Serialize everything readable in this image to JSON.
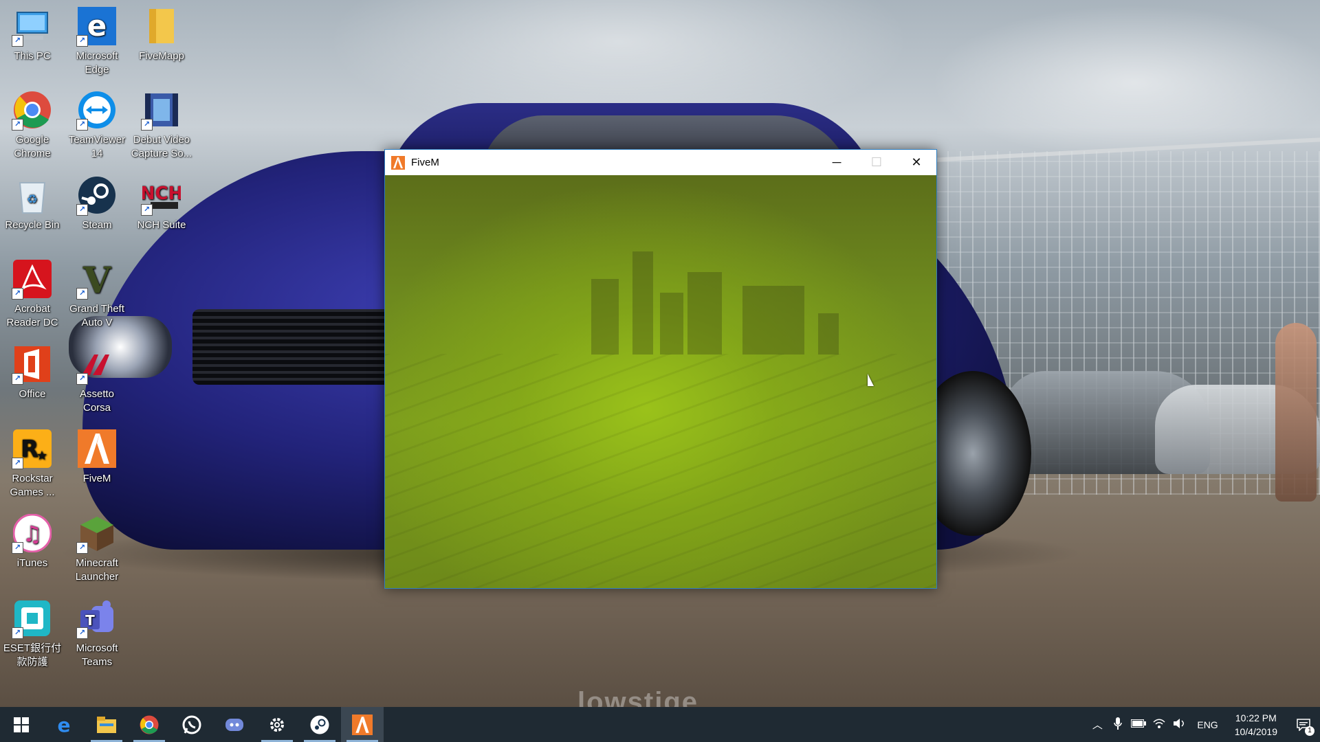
{
  "desktop": {
    "icons": [
      {
        "label": "This PC",
        "icon": "computer-icon"
      },
      {
        "label": "Microsoft Edge",
        "icon": "edge-icon"
      },
      {
        "label": "FiveMapp",
        "icon": "folder-icon"
      },
      {
        "label": "Google Chrome",
        "icon": "chrome-icon"
      },
      {
        "label": "TeamViewer 14",
        "icon": "teamviewer-icon"
      },
      {
        "label": "Debut Video Capture So...",
        "icon": "video-capture-icon"
      },
      {
        "label": "Recycle Bin",
        "icon": "recycle-bin-icon"
      },
      {
        "label": "Steam",
        "icon": "steam-icon"
      },
      {
        "label": "NCH Suite",
        "icon": "nch-icon"
      },
      {
        "label": "Acrobat Reader DC",
        "icon": "acrobat-icon"
      },
      {
        "label": "Grand Theft Auto V",
        "icon": "gta-icon"
      },
      {
        "label": "Office",
        "icon": "office-icon"
      },
      {
        "label": "Assetto Corsa",
        "icon": "assetto-corsa-icon"
      },
      {
        "label": "Rockstar Games ...",
        "icon": "rockstar-icon"
      },
      {
        "label": "FiveM",
        "icon": "fivem-icon"
      },
      {
        "label": "iTunes",
        "icon": "itunes-icon"
      },
      {
        "label": "Minecraft Launcher",
        "icon": "minecraft-icon"
      },
      {
        "label": "ESET銀行付款防護",
        "icon": "eset-icon"
      },
      {
        "label": "Microsoft Teams",
        "icon": "teams-icon"
      }
    ],
    "watermark": "lowstige"
  },
  "window": {
    "title": "FiveM",
    "minimize": "─",
    "maximize": "☐",
    "close": "✕"
  },
  "taskbar": {
    "items": [
      "start-icon",
      "edge-icon",
      "file-explorer-icon",
      "chrome-icon",
      "whatsapp-icon",
      "discord-icon",
      "settings-icon",
      "steam-icon",
      "fivem-icon"
    ],
    "tray": {
      "language": "ENG",
      "time": "10:22 PM",
      "date": "10/4/2019",
      "notification_count": "1"
    }
  },
  "colors": {
    "taskbar": "#1f2a33",
    "fivem_orange": "#f07a2a",
    "window_green": "#7c9c1e"
  }
}
